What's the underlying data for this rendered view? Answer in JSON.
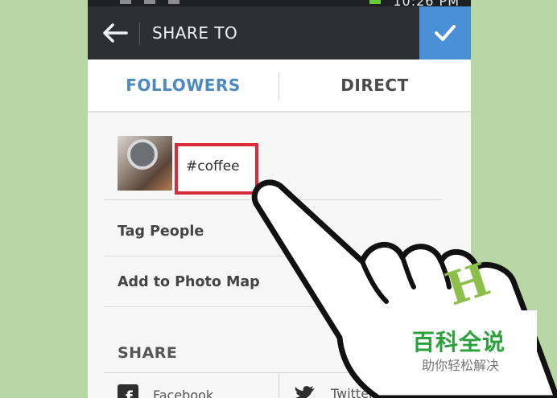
{
  "header": {
    "time": "10:26 PM",
    "title": "SHARE TO"
  },
  "tabs": [
    {
      "label": "FOLLOWERS",
      "active": true
    },
    {
      "label": "DIRECT",
      "active": false
    }
  ],
  "caption": {
    "text": "#coffee",
    "highlight_color": "#d82c3a"
  },
  "options": [
    {
      "label": "Tag People"
    },
    {
      "label": "Add to Photo Map",
      "toggle_on": false
    }
  ],
  "share": {
    "heading": "SHARE",
    "services": [
      {
        "label": "Facebook",
        "icon": "facebook-icon"
      },
      {
        "label": "Twitter",
        "icon": "twitter-icon"
      }
    ]
  },
  "colors": {
    "accent_blue": "#4a90d6",
    "tab_active": "#4c88c2",
    "titlebar": "#2d2f33",
    "background": "#b9d6a6",
    "watermark_green": "#2aa13b"
  },
  "watermark": {
    "brand": "百科全说",
    "tagline": "助你轻松解决",
    "logo_letter": "H"
  }
}
